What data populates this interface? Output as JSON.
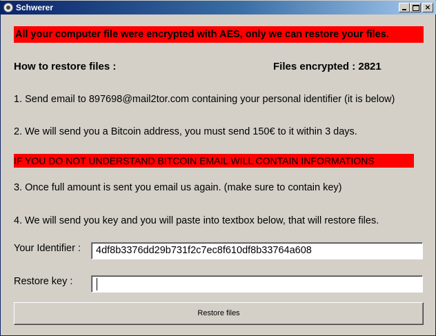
{
  "window": {
    "title": "Schwerer",
    "icon": "app-icon",
    "controls": {
      "minimize": "minimize-icon",
      "maximize": "maximize-icon",
      "close": "×"
    }
  },
  "colors": {
    "titlebar": "#0a246a",
    "alert": "#ff0000",
    "face": "#d4d0c8"
  },
  "banner": "All your computer file were encrypted with AES, only we can restore your files.",
  "how_to_title": "How to restore files :",
  "files_encrypted": "Files encrypted : 2821",
  "steps": {
    "step1": "1. Send email to 897698@mail2tor.com containing your personal identifier (it is below)",
    "step2": "2. We will send you a Bitcoin address, you must send 150€ to it within 3 days.",
    "warning": "IF YOU DO NOT UNDERSTAND BITCOIN EMAIL WILL CONTAIN INFORMATIONS",
    "step3": "3. Once full amount is sent you email us again. (make sure to contain key)",
    "step4": "4. We will send you key and you will paste into textbox below, that will restore files."
  },
  "identifier": {
    "label": "Your Identifier :",
    "value": "4df8b3376dd29b731f2c7ec8f610df8b33764a608"
  },
  "restore_key": {
    "label": "Restore key :",
    "value": ""
  },
  "restore_button": "Restore files"
}
